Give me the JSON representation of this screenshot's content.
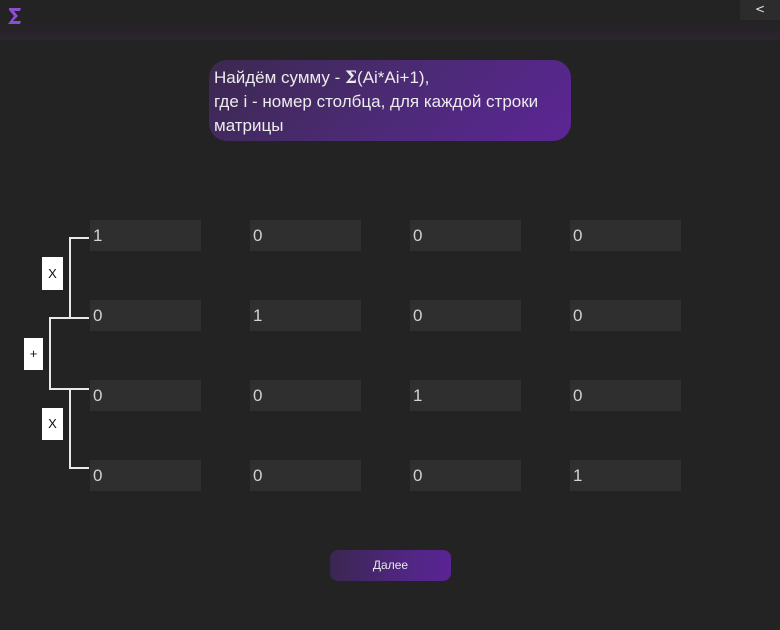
{
  "titlebar": {
    "logo_icon": "sigma-logo-icon",
    "back_label": "<"
  },
  "task": {
    "line1_prefix": "Найдём сумму - ",
    "sigma": "Σ",
    "line1_suffix": "(Ai*Ai+1),",
    "line2": "где i - номер столбца, для каждой строки",
    "line3": "матрицы"
  },
  "matrix": [
    [
      "1",
      "0",
      "0",
      "0"
    ],
    [
      "0",
      "1",
      "0",
      "0"
    ],
    [
      "0",
      "0",
      "1",
      "0"
    ],
    [
      "0",
      "0",
      "0",
      "1"
    ]
  ],
  "operators": {
    "multiply_top": "X",
    "plus": "+",
    "multiply_bottom": "X"
  },
  "next_label": "Далее",
  "colors": {
    "background": "#232323",
    "accent": "#5c2595",
    "cell": "#2f2f2f"
  }
}
